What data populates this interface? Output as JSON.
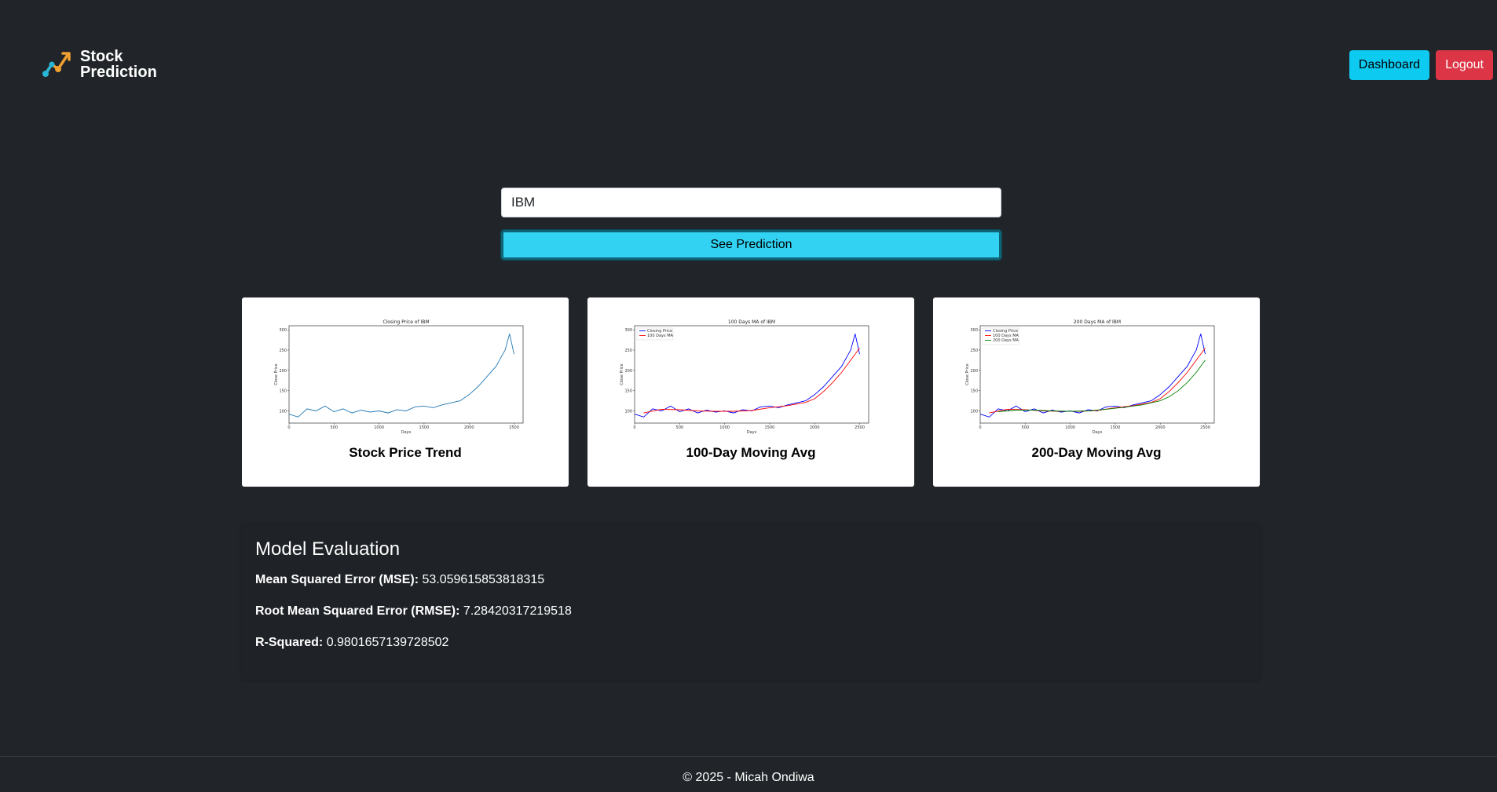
{
  "brand": {
    "line1": "Stock",
    "line2": "Prediction"
  },
  "nav": {
    "dashboard_label": "Dashboard",
    "logout_label": "Logout"
  },
  "form": {
    "ticker_value": "IBM",
    "submit_label": "See Prediction"
  },
  "cards": [
    {
      "caption": "Stock Price Trend"
    },
    {
      "caption": "100-Day Moving Avg"
    },
    {
      "caption": "200-Day Moving Avg"
    }
  ],
  "evaluation": {
    "title": "Model Evaluation",
    "mse_label": "Mean Squared Error (MSE):",
    "mse_value": "53.059615853818315",
    "rmse_label": "Root Mean Squared Error (RMSE):",
    "rmse_value": "7.28420317219518",
    "r2_label": "R-Squared:",
    "r2_value": "0.9801657139728502"
  },
  "footer": {
    "text": "© 2025 - Micah Ondiwa"
  },
  "colors": {
    "background": "#212529",
    "info": "#0dcaf0",
    "danger": "#dc3545"
  },
  "chart_data": [
    {
      "type": "line",
      "title": "Closing Price of IBM",
      "xlabel": "Days",
      "ylabel": "Close Price",
      "xlim": [
        0,
        2600
      ],
      "ylim": [
        70,
        310
      ],
      "xticks": [
        0,
        500,
        1000,
        1500,
        2000,
        2500
      ],
      "yticks": [
        100,
        150,
        200,
        250,
        300
      ],
      "series": [
        {
          "name": "",
          "color": "#1f77b4",
          "x": [
            0,
            100,
            200,
            300,
            400,
            500,
            600,
            700,
            800,
            900,
            1000,
            1100,
            1200,
            1300,
            1400,
            1500,
            1600,
            1700,
            1800,
            1900,
            2000,
            2100,
            2200,
            2300,
            2350,
            2400,
            2450,
            2480,
            2500
          ],
          "y": [
            92,
            85,
            105,
            100,
            112,
            98,
            105,
            95,
            102,
            97,
            100,
            95,
            103,
            100,
            110,
            112,
            108,
            115,
            120,
            125,
            140,
            160,
            185,
            210,
            230,
            250,
            290,
            260,
            240
          ]
        }
      ]
    },
    {
      "type": "line",
      "title": "100 Days MA of IBM",
      "xlabel": "Days",
      "ylabel": "Close Price",
      "xlim": [
        0,
        2600
      ],
      "ylim": [
        70,
        310
      ],
      "xticks": [
        0,
        500,
        1000,
        1500,
        2000,
        2500
      ],
      "yticks": [
        100,
        150,
        200,
        250,
        300
      ],
      "legend": "top-left",
      "series": [
        {
          "name": "Closing Price",
          "color": "#0000ff",
          "x": [
            0,
            100,
            200,
            300,
            400,
            500,
            600,
            700,
            800,
            900,
            1000,
            1100,
            1200,
            1300,
            1400,
            1500,
            1600,
            1700,
            1800,
            1900,
            2000,
            2100,
            2200,
            2300,
            2350,
            2400,
            2450,
            2480,
            2500
          ],
          "y": [
            92,
            85,
            105,
            100,
            112,
            98,
            105,
            95,
            102,
            97,
            100,
            95,
            103,
            100,
            110,
            112,
            108,
            115,
            120,
            125,
            140,
            160,
            185,
            210,
            230,
            250,
            290,
            260,
            240
          ]
        },
        {
          "name": "100 Days MA",
          "color": "#ff0000",
          "x": [
            100,
            300,
            500,
            700,
            900,
            1100,
            1300,
            1500,
            1700,
            1900,
            2000,
            2100,
            2200,
            2300,
            2400,
            2500
          ],
          "y": [
            95,
            104,
            103,
            100,
            99,
            99,
            101,
            108,
            113,
            121,
            130,
            148,
            170,
            195,
            225,
            255
          ]
        }
      ]
    },
    {
      "type": "line",
      "title": "200 Days MA of IBM",
      "xlabel": "Days",
      "ylabel": "Close Price",
      "xlim": [
        0,
        2600
      ],
      "ylim": [
        70,
        310
      ],
      "xticks": [
        0,
        500,
        1000,
        1500,
        2000,
        2500
      ],
      "yticks": [
        100,
        150,
        200,
        250,
        300
      ],
      "legend": "top-left",
      "series": [
        {
          "name": "Closing Price",
          "color": "#0000ff",
          "x": [
            0,
            100,
            200,
            300,
            400,
            500,
            600,
            700,
            800,
            900,
            1000,
            1100,
            1200,
            1300,
            1400,
            1500,
            1600,
            1700,
            1800,
            1900,
            2000,
            2100,
            2200,
            2300,
            2350,
            2400,
            2450,
            2480,
            2500
          ],
          "y": [
            92,
            85,
            105,
            100,
            112,
            98,
            105,
            95,
            102,
            97,
            100,
            95,
            103,
            100,
            110,
            112,
            108,
            115,
            120,
            125,
            140,
            160,
            185,
            210,
            230,
            250,
            290,
            260,
            240
          ]
        },
        {
          "name": "100 Days MA",
          "color": "#ff0000",
          "x": [
            100,
            300,
            500,
            700,
            900,
            1100,
            1300,
            1500,
            1700,
            1900,
            2000,
            2100,
            2200,
            2300,
            2400,
            2500
          ],
          "y": [
            95,
            104,
            103,
            100,
            99,
            99,
            101,
            108,
            113,
            121,
            130,
            148,
            170,
            195,
            225,
            255
          ]
        },
        {
          "name": "200 Days MA",
          "color": "#008000",
          "x": [
            200,
            400,
            600,
            800,
            1000,
            1200,
            1400,
            1600,
            1800,
            2000,
            2100,
            2200,
            2300,
            2400,
            2500
          ],
          "y": [
            98,
            102,
            102,
            100,
            99,
            100,
            104,
            109,
            115,
            125,
            135,
            150,
            170,
            195,
            225
          ]
        }
      ]
    }
  ]
}
